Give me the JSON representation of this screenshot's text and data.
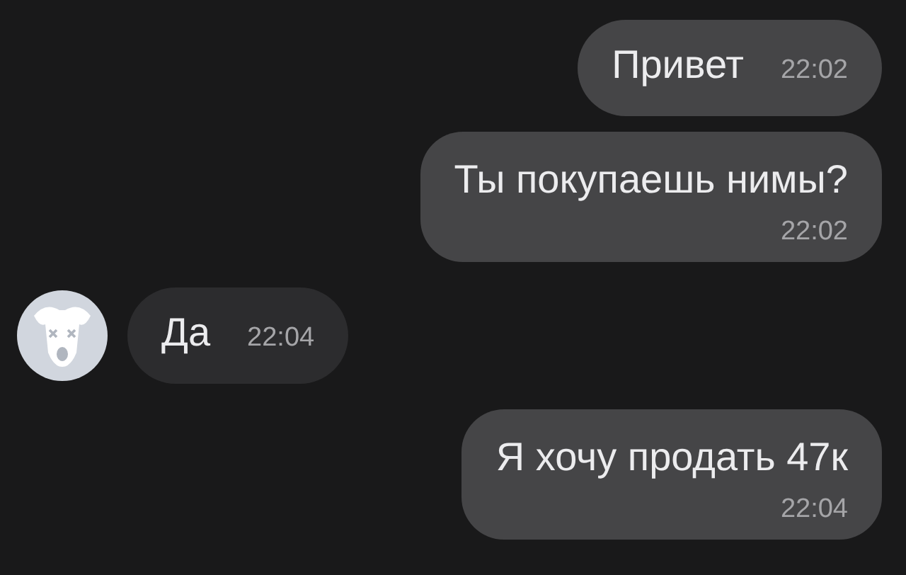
{
  "messages": [
    {
      "incoming": false,
      "time_below": false,
      "text": "Привет",
      "time": "22:02"
    },
    {
      "incoming": false,
      "time_below": true,
      "text": "Ты покупаешь нимы?",
      "time": "22:02"
    },
    {
      "incoming": true,
      "time_below": false,
      "text": "Да",
      "time": "22:04"
    },
    {
      "incoming": false,
      "time_below": true,
      "text": "Я хочу продать 47к",
      "time": "22:04"
    }
  ]
}
